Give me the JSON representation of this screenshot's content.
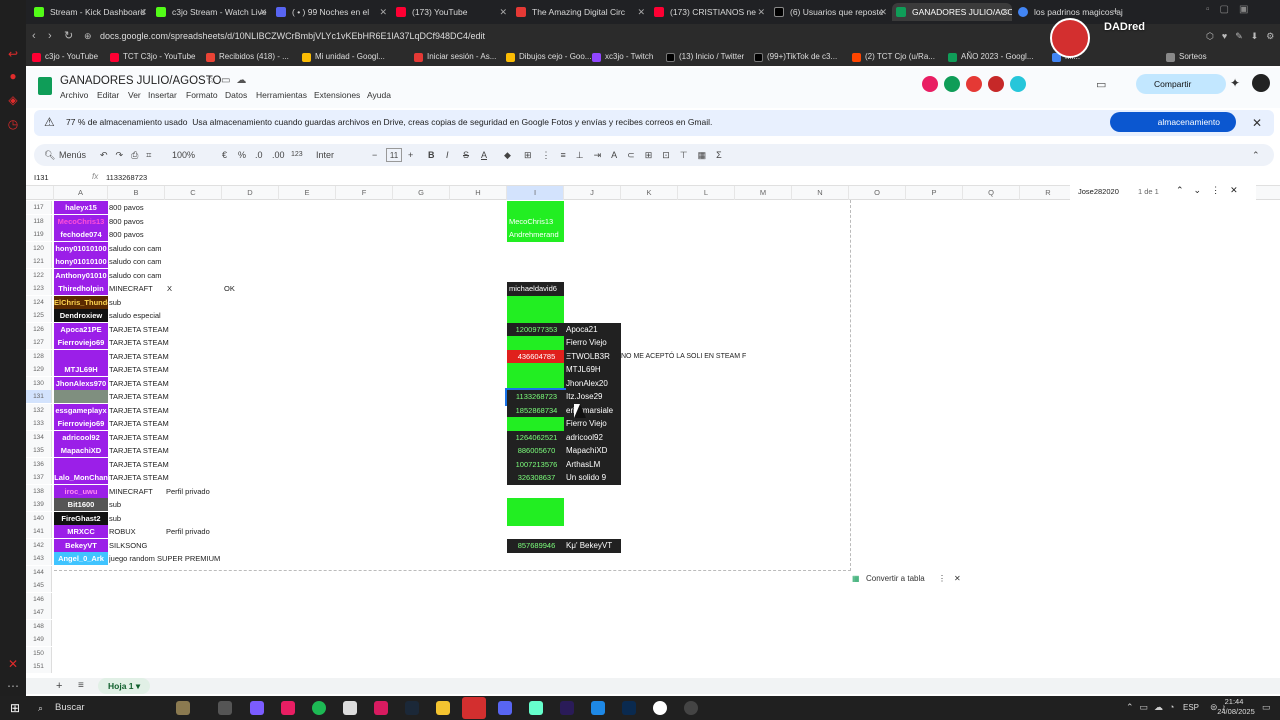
{
  "browser": {
    "tabs": [
      {
        "label": "Stream - Kick Dashboard",
        "color": "#53fc18"
      },
      {
        "label": "c3jo Stream - Watch Live",
        "color": "#53fc18"
      },
      {
        "label": "( • ) 99 Noches en el",
        "color": "#5865f2"
      },
      {
        "label": "(173) YouTube",
        "color": "#ff0033"
      },
      {
        "label": "The Amazing Digital Circ",
        "color": "#e53935"
      },
      {
        "label": "(173) CRISTIANOS ne",
        "color": "#ff0033"
      },
      {
        "label": "(6) Usuarios que reposte",
        "color": "#000000"
      },
      {
        "label": "GANADORES JULIO/AGO",
        "color": "#0f9d58"
      },
      {
        "label": "los padrinos magicos aj",
        "color": "#4285f4"
      }
    ],
    "url": "docs.google.com/spreadsheets/d/10NLIBCZWCrBmbjVLYc1vKEbHR6E1lA37LqDCf948DC4/edit",
    "bookmarks": [
      {
        "label": "c3jo - YouTube",
        "color": "#ff0033"
      },
      {
        "label": "TCT C3jo - YouTube",
        "color": "#ff0033"
      },
      {
        "label": "Recibidos (418) - ...",
        "color": "#ea4335"
      },
      {
        "label": "Mi unidad - Googl...",
        "color": "#fbbc04"
      },
      {
        "label": "Iniciar sesión - As...",
        "color": "#e53935"
      },
      {
        "label": "Dibujos cejo - Goo...",
        "color": "#fbbc04"
      },
      {
        "label": "xc3jo - Twitch",
        "color": "#9146ff"
      },
      {
        "label": "(13) Inicio / Twitter",
        "color": "#000000"
      },
      {
        "label": "(99+)TikTok de c3...",
        "color": "#000000"
      },
      {
        "label": "(2) TCT Cjo (u/Ra...",
        "color": "#ff4500"
      },
      {
        "label": "AÑO 2023 - Googl...",
        "color": "#0f9d58"
      },
      {
        "label": "Mi...",
        "color": "#4285f4"
      },
      {
        "label": "Sorteos",
        "color": "#888888"
      }
    ],
    "overlay_user": "DADred"
  },
  "sheet": {
    "title": "GANADORES JULIO/AGOSTO",
    "menus": [
      "Archivo",
      "Editar",
      "Ver",
      "Insertar",
      "Formato",
      "Datos",
      "Herramientas",
      "Extensiones",
      "Ayuda"
    ],
    "share_label": "Compartir",
    "notice": {
      "bold": "77 % de almacenamiento usado",
      "text": "Usa almacenamiento cuando guardas archivos en Drive, creas copias de seguridad en Google Fotos y envías y recibes correos en Gmail.",
      "button": "almacenamiento"
    },
    "toolbar": {
      "menus": "Menús",
      "zoom": "100%",
      "currency": "€",
      "percent": "%",
      "dec_down": ".0",
      "dec_up": ".00",
      "format123": "123",
      "font": "Inter",
      "font_size": "11"
    },
    "cell_ref": "I131",
    "formula": "1133268723",
    "find": {
      "query": "Jose282020",
      "count": "1 de 1"
    },
    "columns": [
      "A",
      "B",
      "C",
      "D",
      "E",
      "F",
      "G",
      "H",
      "I",
      "J",
      "K",
      "L",
      "M",
      "N",
      "O",
      "P",
      "Q",
      "R"
    ],
    "rows": [
      {
        "n": "117",
        "a": "haleyx15",
        "ac": "#9b1fe8",
        "b": "800 pavos",
        "i": "",
        "ic": "grn"
      },
      {
        "n": "118",
        "a": "MecoChris13",
        "ac": "#9b1fe8",
        "af": "#ff4fd8",
        "b": "800 pavos",
        "i": "MecoChris13",
        "ic": "grn"
      },
      {
        "n": "119",
        "a": "fechode074",
        "ac": "#9b1fe8",
        "b": "800 pavos",
        "i": "Andrehmerand",
        "ic": "grn"
      },
      {
        "n": "120",
        "a": "hony01010100",
        "ac": "#9b1fe8",
        "b": "saludo con cam"
      },
      {
        "n": "121",
        "a": "hony01010100",
        "ac": "#9b1fe8",
        "b": "saludo con cam"
      },
      {
        "n": "122",
        "a": "Anthony01010",
        "ac": "#9b1fe8",
        "b": "saludo con cam"
      },
      {
        "n": "123",
        "a": "Thiredholpin",
        "ac": "#9b1fe8",
        "b": "MINECRAFT",
        "c": "X",
        "d": "OK",
        "i": "michaeldavid6",
        "ic": "blk"
      },
      {
        "n": "124",
        "a": "ElChris_Thunde",
        "ac": "#5b2a00",
        "af": "#ffd54f",
        "b": "sub",
        "i": "",
        "ic": "grn"
      },
      {
        "n": "125",
        "a": "Dendroxiew",
        "ac": "#111111",
        "b": "saludo especial",
        "i": "",
        "ic": "grn"
      },
      {
        "n": "126",
        "a": "Apoca21PE",
        "ac": "#9b1fe8",
        "b": "TARJETA STEAM",
        "i": "1200977353",
        "ic": "blk",
        "j": "Apoca21"
      },
      {
        "n": "127",
        "a": "Fierroviejo69",
        "ac": "#9b1fe8",
        "b": "TARJETA STEAM",
        "i": "",
        "ic": "grn",
        "j": "Fierro Viejo"
      },
      {
        "n": "128",
        "a": "",
        "ac": "#9b1fe8",
        "b": "TARJETA STEAM",
        "i": "436604785",
        "ic": "red",
        "j": "ΞTWOLB3R",
        "k": "NO ME ACEPTÓ LA SOLI EN STEAM F"
      },
      {
        "n": "129",
        "a": "MTJL69H",
        "ac": "#9b1fe8",
        "b": "TARJETA STEAM",
        "i": "",
        "ic": "grn",
        "j": "MTJL69H"
      },
      {
        "n": "130",
        "a": "JhonAlexs970",
        "ac": "#9b1fe8",
        "b": "TARJETA STEAM",
        "i": "",
        "ic": "grn",
        "j": "JhonAlex20"
      },
      {
        "n": "131",
        "a": "",
        "ac": "#7f8f7f",
        "b": "TARJETA STEAM",
        "i": "1133268723",
        "ic": "blk",
        "j": "Itz.Jose29"
      },
      {
        "n": "132",
        "a": "essgameplayx",
        "ac": "#9b1fe8",
        "b": "TARJETA STEAM",
        "i": "1852868734",
        "ic": "blk",
        "j": "erickmarsiale"
      },
      {
        "n": "133",
        "a": "Fierroviejo69",
        "ac": "#9b1fe8",
        "b": "TARJETA STEAM",
        "i": "",
        "ic": "grn",
        "j": "Fierro Viejo"
      },
      {
        "n": "134",
        "a": "adricool92",
        "ac": "#9b1fe8",
        "b": "TARJETA STEAM",
        "i": "1264062521",
        "ic": "blk",
        "j": "adricool92"
      },
      {
        "n": "135",
        "a": "MapachiXD",
        "ac": "#9b1fe8",
        "b": "TARJETA STEAM",
        "i": "886005670",
        "ic": "blk",
        "j": "MapachiXD"
      },
      {
        "n": "136",
        "a": "",
        "ac": "#9b1fe8",
        "b": "TARJETA STEAM",
        "i": "1007213576",
        "ic": "blk",
        "j": "ArthasLM"
      },
      {
        "n": "137",
        "a": "Lalo_MonChan",
        "ac": "#9b1fe8",
        "b": "TARJETA STEAM",
        "i": "326308637",
        "ic": "blk",
        "j": "Un solido 9"
      },
      {
        "n": "138",
        "a": "iroc_uwu",
        "ac": "#9b1fe8",
        "af": "#ff8af0",
        "b": "MINECRAFT",
        "c": "Perfil privado"
      },
      {
        "n": "139",
        "a": "Bit1600",
        "ac": "#555555",
        "b": "sub",
        "i": "",
        "ic": "grn"
      },
      {
        "n": "140",
        "a": "FireGhast2",
        "ac": "#111111",
        "b": "sub",
        "i": "",
        "ic": "grn"
      },
      {
        "n": "141",
        "a": "MRXCC",
        "ac": "#9b1fe8",
        "b": "ROBUX",
        "c": "Perfil privado"
      },
      {
        "n": "142",
        "a": "BekeyVT",
        "ac": "#9b1fe8",
        "b": "SILKSONG",
        "i": "857689946",
        "ic": "blk",
        "j": "Kμ' BekeyVT"
      },
      {
        "n": "143",
        "a": "Angel_0_Ark",
        "ac": "#40c4ff",
        "b": "juego random SUPER PREMIUM"
      },
      {
        "n": "144"
      },
      {
        "n": "145"
      },
      {
        "n": "146"
      },
      {
        "n": "147"
      },
      {
        "n": "148"
      },
      {
        "n": "149"
      },
      {
        "n": "150"
      },
      {
        "n": "151"
      }
    ],
    "convert_label": "Convertir a tabla",
    "sheet_tab": "Hoja 1"
  },
  "taskbar": {
    "search": "Buscar",
    "lang": "ESP",
    "time": "21:44",
    "date": "24/08/2025"
  }
}
